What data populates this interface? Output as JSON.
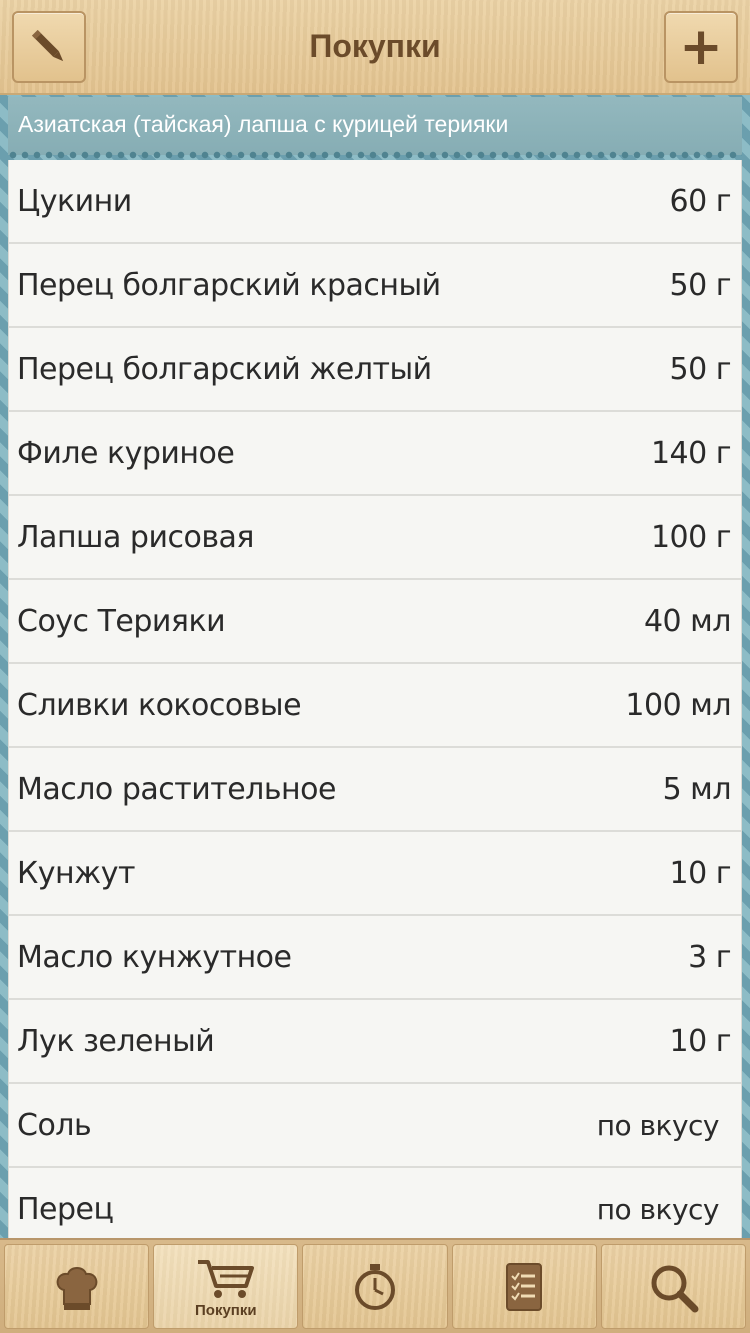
{
  "header": {
    "title": "Покупки",
    "left_icon": "pencil-icon",
    "right_icon": "plus-icon",
    "plus_glyph": "+"
  },
  "recipe": {
    "title": "Азиатская (тайская) лапша с курицей терияки"
  },
  "items": [
    {
      "name": "Цукини",
      "qty": "60 г"
    },
    {
      "name": "Перец болгарский красный",
      "qty": "50 г"
    },
    {
      "name": "Перец болгарский желтый",
      "qty": "50 г"
    },
    {
      "name": "Филе куриное",
      "qty": "140 г"
    },
    {
      "name": "Лапша рисовая",
      "qty": "100 г"
    },
    {
      "name": "Соус Терияки",
      "qty": "40 мл"
    },
    {
      "name": "Сливки кокосовые",
      "qty": "100 мл"
    },
    {
      "name": "Масло растительное",
      "qty": "5 мл"
    },
    {
      "name": "Кунжут",
      "qty": "10 г"
    },
    {
      "name": "Масло кунжутное",
      "qty": "3 г"
    },
    {
      "name": "Лук зеленый",
      "qty": "10 г"
    },
    {
      "name": "Соль",
      "qty": "по вкусу"
    },
    {
      "name": "Перец",
      "qty": "по вкусу"
    }
  ],
  "tabs": [
    {
      "icon": "chef-hat-icon",
      "label": ""
    },
    {
      "icon": "cart-icon",
      "label": "Покупки",
      "active": true
    },
    {
      "icon": "timer-icon",
      "label": ""
    },
    {
      "icon": "checklist-icon",
      "label": ""
    },
    {
      "icon": "search-icon",
      "label": ""
    }
  ],
  "colors": {
    "wood": "#e4c490",
    "accent_text": "#6b4b2a",
    "recipe_strip": "#8cb2b9",
    "side_pattern": "#6fa6b3"
  }
}
